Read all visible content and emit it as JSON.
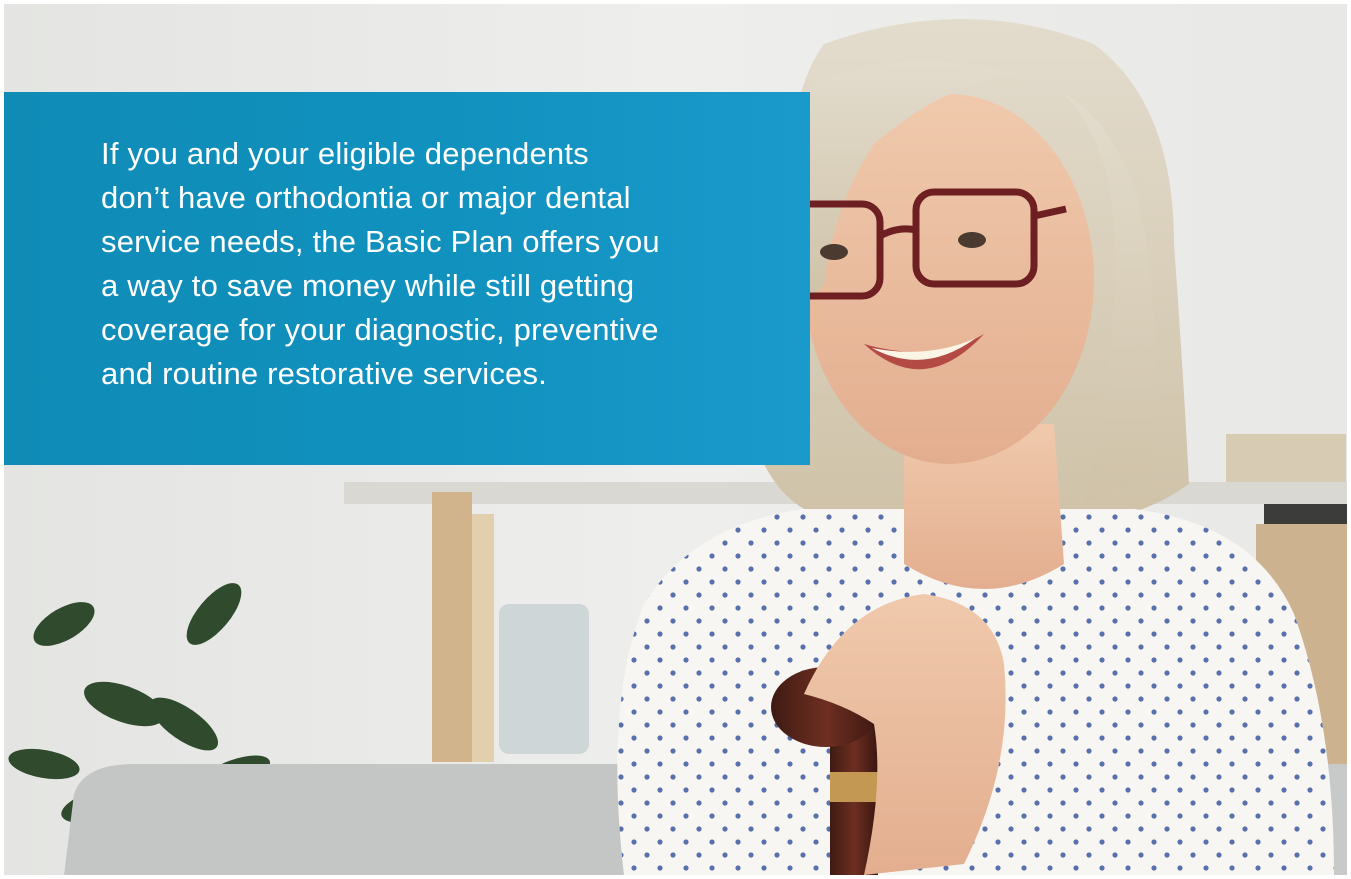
{
  "callout": {
    "text": "If you and your eligible dependents don’t have orthodontia or major dental service needs, the Basic Plan offers you a way to save money while still getting coverage for your diagnostic, preventive and routine restorative services.",
    "background_color": "#1192bf",
    "text_color": "#ffffff"
  },
  "photo": {
    "subject": "smiling-senior-woman-with-glasses-holding-cane",
    "icon": "photo-icon"
  }
}
